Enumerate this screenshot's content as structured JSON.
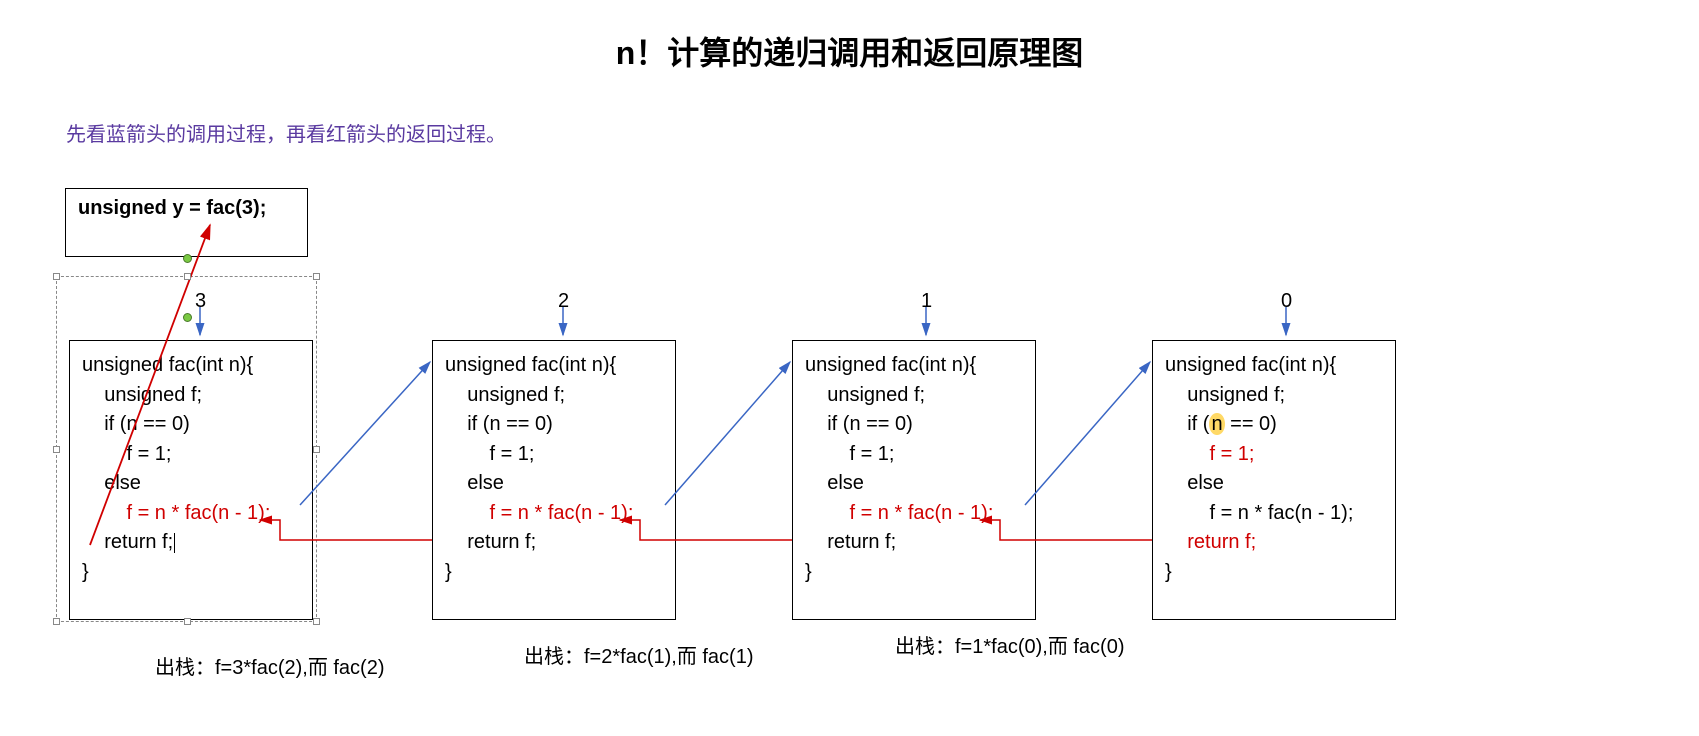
{
  "title": "n！计算的递归调用和返回原理图",
  "subtitle": "先看蓝箭头的调用过程，再看红箭头的返回过程。",
  "top_call": "unsigned y = fac(3);",
  "n_labels": [
    "3",
    "2",
    "1",
    "0"
  ],
  "code": {
    "l1": "unsigned fac(int n){",
    "l2": "    unsigned f;",
    "l3": "    if (n == 0)",
    "l3_highlight_pre": "    if (",
    "l3_highlight_n": "n",
    "l3_highlight_post": " == 0)",
    "l4": "        f = 1;",
    "l5": "    else",
    "l6_pre": "        ",
    "l6_red": "f = n * fac(n - 1);",
    "l7": "    return f;",
    "l7_cursor": "    return f;",
    "l8": "}"
  },
  "footer": {
    "f1": "出栈：f=3*fac(2),而 fac(2)",
    "f2": "出栈：f=2*fac(1),而 fac(1)",
    "f3": "出栈：f=1*fac(0),而 fac(0)"
  }
}
